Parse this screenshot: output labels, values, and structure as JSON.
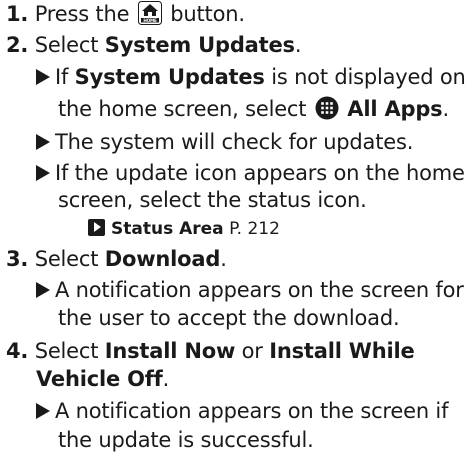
{
  "steps": {
    "s1": {
      "num": "1.",
      "pre": "Press the",
      "post": "button.",
      "icon": "home-button-icon"
    },
    "s2": {
      "num": "2.",
      "pre": "Select",
      "bold": "System Updates",
      "post": "."
    },
    "s2_bullet1": {
      "line1_pre": "If",
      "line1_bold": "System Updates",
      "line1_post": "is not displayed on",
      "line2_pre": "the home screen, select",
      "line2_bold": "All Apps",
      "line2_post": ".",
      "icon": "all-apps-icon"
    },
    "s2_bullet2": {
      "text": "The system will check for updates."
    },
    "s2_bullet3": {
      "line1": "If the update icon appears on the home",
      "line2": "screen, select the status icon."
    },
    "s2_ref": {
      "bold": "Status Area",
      "page": "P. 212",
      "icon": "reference-arrow-icon"
    },
    "s3": {
      "num": "3.",
      "pre": "Select",
      "bold": "Download",
      "post": "."
    },
    "s3_bullet1": {
      "line1": "A notification appears on the screen for",
      "line2": "the user to accept the download."
    },
    "s4": {
      "num": "4.",
      "pre": "Select",
      "bold1": "Install Now",
      "mid": "or",
      "bold2": "Install While",
      "line2_bold": "Vehicle Off",
      "line2_post": "."
    },
    "s4_bullet1": {
      "line1": "A notification appears on the screen if",
      "line2": "the update is successful."
    }
  },
  "colors": {
    "text": "#1a1a1a",
    "background": "#ffffff"
  }
}
